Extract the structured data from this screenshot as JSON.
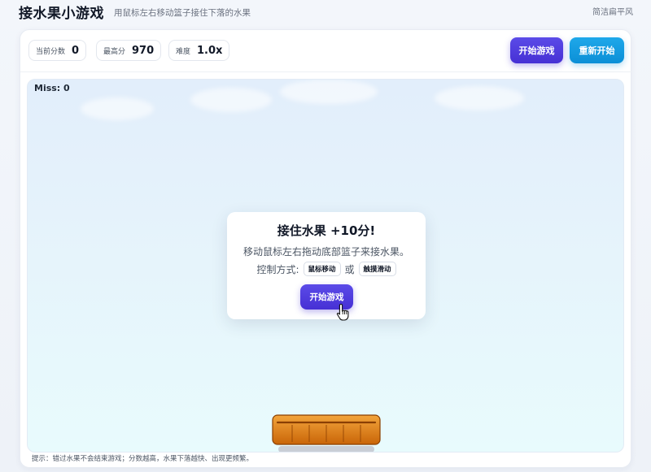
{
  "header": {
    "title": "接水果小游戏",
    "subtitle": "用鼠标左右移动篮子接住下落的水果",
    "style_tag": "简洁扁平风"
  },
  "stats": {
    "score_label": "当前分数",
    "score_value": "0",
    "best_label": "最高分",
    "best_value": "970",
    "difficulty_label": "难度",
    "difficulty_value": "1.0x"
  },
  "toolbar": {
    "start_label": "开始游戏",
    "restart_label": "重新开始"
  },
  "stage": {
    "miss_text": "Miss: 0"
  },
  "modal": {
    "title": "接住水果 +10分!",
    "description": "移动鼠标左右拖动底部篮子来接水果。",
    "controls_label": "控制方式:",
    "control_mouse": "鼠标移动",
    "control_or": "或",
    "control_touch": "触摸滑动",
    "start_label": "开始游戏"
  },
  "footer": {
    "hint": "提示：错过水果不会结束游戏；分数越高，水果下落越快、出现更频繁。"
  },
  "colors": {
    "primary": "#4f3ddf",
    "secondary": "#0b9ae0",
    "basket": "#e07a10",
    "sky_top": "#e2eefb",
    "sky_bottom": "#e8fbfd"
  },
  "icons": {
    "cursor": "hand-pointer-icon"
  }
}
